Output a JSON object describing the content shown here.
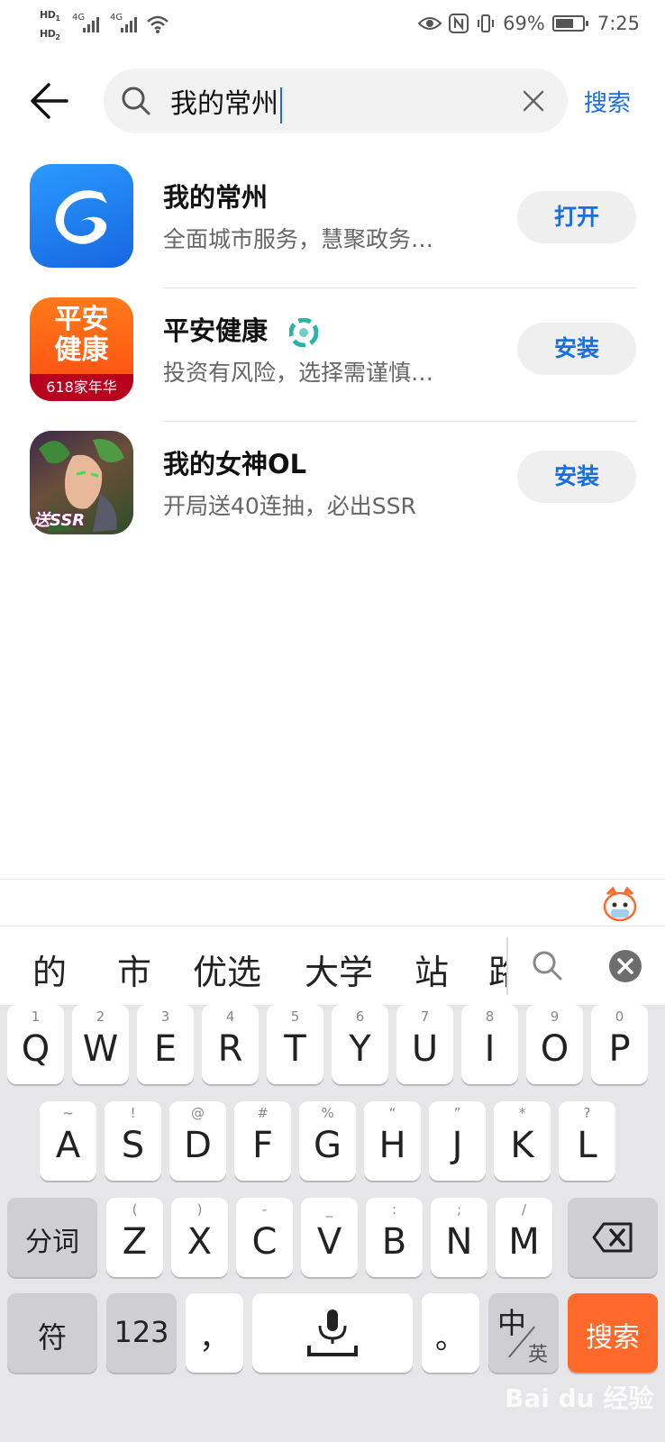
{
  "status_bar": {
    "hd1": "HD",
    "hd1_sub": "1",
    "hd2": "HD",
    "hd2_sub": "2",
    "net1": "4G",
    "net2": "4G",
    "battery": "69%",
    "battery_level": 0.69,
    "time": "7:25"
  },
  "search": {
    "query": "我的常州",
    "button_label": "搜索"
  },
  "results": [
    {
      "name": "我的常州",
      "description": "全面城市服务，慧聚政务…",
      "action": "打开"
    },
    {
      "name": "平安健康",
      "description": "投资有风险，选择需谨慎…",
      "action": "安装",
      "icon_text_top": "平安",
      "icon_text_mid": "健康",
      "icon_text_bottom": "618家年华"
    },
    {
      "name": "我的女神OL",
      "description": "开局送40连抽，必出SSR",
      "action": "安装",
      "icon_text_bottom": "送SSR"
    }
  ],
  "keyboard": {
    "candidates": [
      "的",
      "市",
      "优选",
      "大学",
      "站",
      "路"
    ],
    "row1": [
      {
        "main": "Q",
        "sub": "1"
      },
      {
        "main": "W",
        "sub": "2"
      },
      {
        "main": "E",
        "sub": "3"
      },
      {
        "main": "R",
        "sub": "4"
      },
      {
        "main": "T",
        "sub": "5"
      },
      {
        "main": "Y",
        "sub": "6"
      },
      {
        "main": "U",
        "sub": "7"
      },
      {
        "main": "I",
        "sub": "8"
      },
      {
        "main": "O",
        "sub": "9"
      },
      {
        "main": "P",
        "sub": "0"
      }
    ],
    "row2": [
      {
        "main": "A",
        "sub": "~"
      },
      {
        "main": "S",
        "sub": "!"
      },
      {
        "main": "D",
        "sub": "@"
      },
      {
        "main": "F",
        "sub": "#"
      },
      {
        "main": "G",
        "sub": "%"
      },
      {
        "main": "H",
        "sub": "“"
      },
      {
        "main": "J",
        "sub": "”"
      },
      {
        "main": "K",
        "sub": "*"
      },
      {
        "main": "L",
        "sub": "?"
      }
    ],
    "row3": [
      {
        "main": "Z",
        "sub": "("
      },
      {
        "main": "X",
        "sub": ")"
      },
      {
        "main": "C",
        "sub": "-"
      },
      {
        "main": "V",
        "sub": "_"
      },
      {
        "main": "B",
        "sub": ":"
      },
      {
        "main": "N",
        "sub": ";"
      },
      {
        "main": "M",
        "sub": "/"
      }
    ],
    "segment_label": "分词",
    "symbol_label": "符",
    "num_label": "123",
    "comma": "，",
    "period": "。",
    "lang_main": "中",
    "lang_sub": "英",
    "enter_label": "搜索"
  },
  "watermark": "Bai du 经验",
  "colors": {
    "accent": "#1a6fe0",
    "enter": "#ff6a2a"
  }
}
